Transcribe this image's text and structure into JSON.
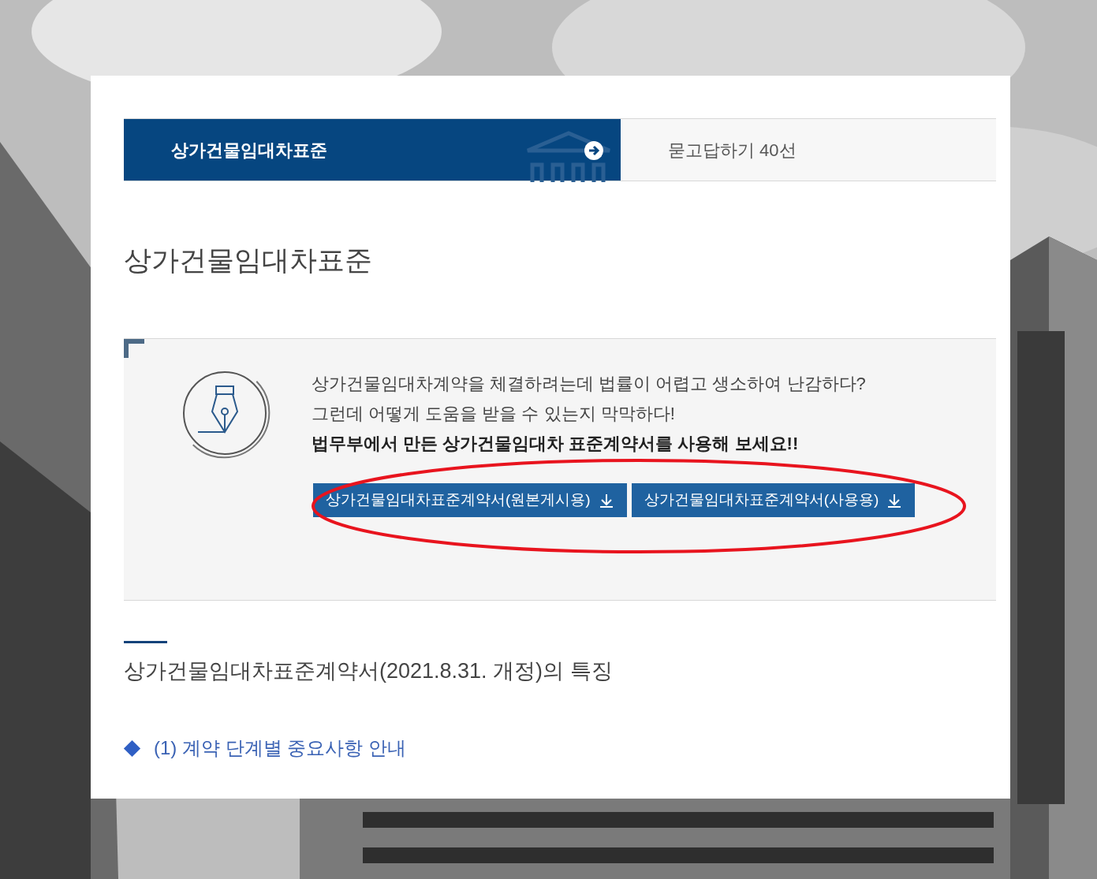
{
  "background": {
    "kind": "picture"
  },
  "tabs": [
    {
      "label": "상가건물임대차표준",
      "selected": true
    },
    {
      "label": "묻고답하기 40선",
      "selected": false
    }
  ],
  "page_title": "상가건물임대차표준",
  "intro": {
    "lines": [
      "상가건물임대차계약을 체결하려는데 법률이 어렵고 생소하여 난감하다?",
      "그런데 어떻게 도움을 받을 수 있는지 막막하다!"
    ],
    "emphasis": "법무부에서 만든 상가건물임대차 표준계약서를 사용해 보세요!!",
    "buttons": [
      "상가건물임대차표준계약서(원본게시용)",
      "상가건물임대차표준계약서(사용용)"
    ]
  },
  "section_heading": "상가건물임대차표준계약서(2021.8.31. 개정)의 특징",
  "section_items": [
    "(1) 계약 단계별 중요사항 안내"
  ]
}
